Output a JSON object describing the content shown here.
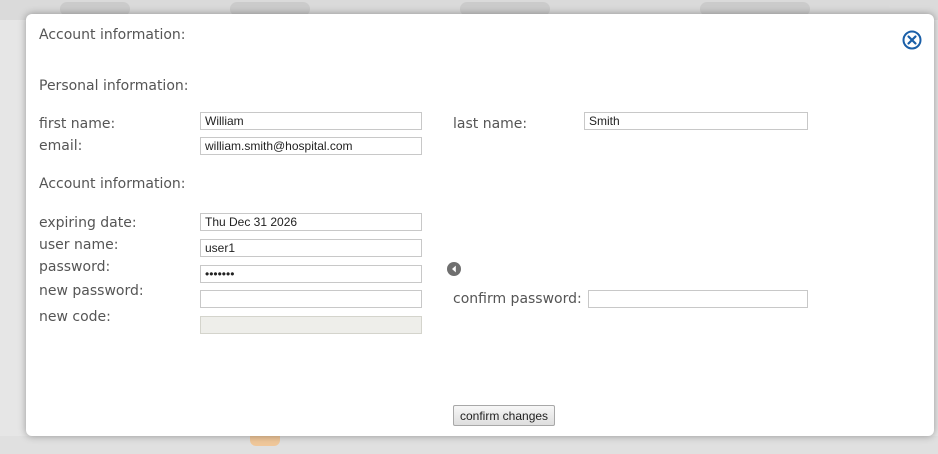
{
  "dialog": {
    "title": "Account information:",
    "close_icon": "close-circle-icon"
  },
  "personal": {
    "heading": "Personal information:",
    "first_name_label": "first name:",
    "first_name_value": "William",
    "last_name_label": "last name:",
    "last_name_value": "Smith",
    "email_label": "email:",
    "email_value": "william.smith@hospital.com"
  },
  "account": {
    "heading": "Account information:",
    "expiring_date_label": "expiring date:",
    "expiring_date_value": "Thu Dec 31 2026",
    "user_name_label": "user name:",
    "user_name_value": "user1",
    "password_label": "password:",
    "password_value": "•••••••",
    "password_toggle_icon": "arrow-left-circle-icon",
    "new_password_label": "new password:",
    "new_password_value": "",
    "confirm_password_label": "confirm password:",
    "confirm_password_value": "",
    "new_code_label": "new code:",
    "new_code_value": ""
  },
  "actions": {
    "confirm_label": "confirm changes"
  },
  "colors": {
    "label_text": "#555555",
    "close_icon": "#1a5fa8",
    "arrow_icon": "#6f6f6f",
    "accent_bottom": "#f0c79a"
  }
}
